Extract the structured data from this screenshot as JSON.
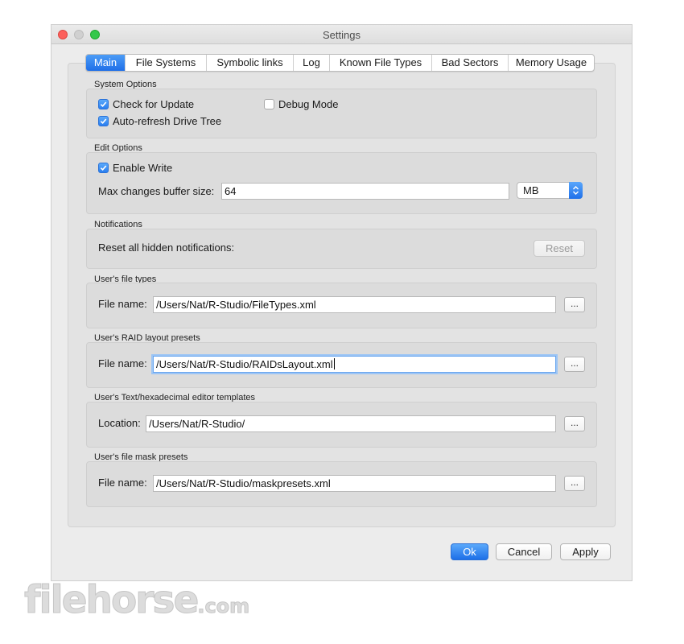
{
  "window": {
    "title": "Settings"
  },
  "tabs": [
    "Main",
    "File Systems",
    "Symbolic links",
    "Log",
    "Known File Types",
    "Bad Sectors",
    "Memory Usage"
  ],
  "system_options": {
    "label": "System Options",
    "check_for_update": {
      "label": "Check for Update",
      "checked": true
    },
    "debug_mode": {
      "label": "Debug Mode",
      "checked": false
    },
    "auto_refresh": {
      "label": "Auto-refresh Drive Tree",
      "checked": true
    }
  },
  "edit_options": {
    "label": "Edit Options",
    "enable_write": {
      "label": "Enable Write",
      "checked": true
    },
    "buffer_label": "Max changes buffer size:",
    "buffer_value": "64",
    "buffer_unit": "MB"
  },
  "notifications": {
    "label": "Notifications",
    "reset_label": "Reset all hidden notifications:",
    "reset_button": "Reset"
  },
  "file_types": {
    "label": "User's file types",
    "field_label": "File name:",
    "value": "/Users/Nat/R-Studio/FileTypes.xml"
  },
  "raid_presets": {
    "label": "User's RAID layout presets",
    "field_label": "File name:",
    "value": "/Users/Nat/R-Studio/RAIDsLayout.xml"
  },
  "editor_templates": {
    "label": "User's Text/hexadecimal editor templates",
    "field_label": "Location:",
    "value": "/Users/Nat/R-Studio/"
  },
  "mask_presets": {
    "label": "User's file mask presets",
    "field_label": "File name:",
    "value": "/Users/Nat/R-Studio/maskpresets.xml"
  },
  "browse_label": "...",
  "buttons": {
    "ok": "Ok",
    "cancel": "Cancel",
    "apply": "Apply"
  },
  "watermark": {
    "word": "filehorse",
    "tld": ".com"
  },
  "colors": {
    "accent": "#1f6fe8",
    "window_bg": "#ececec",
    "group_bg": "#dcdcdc"
  }
}
